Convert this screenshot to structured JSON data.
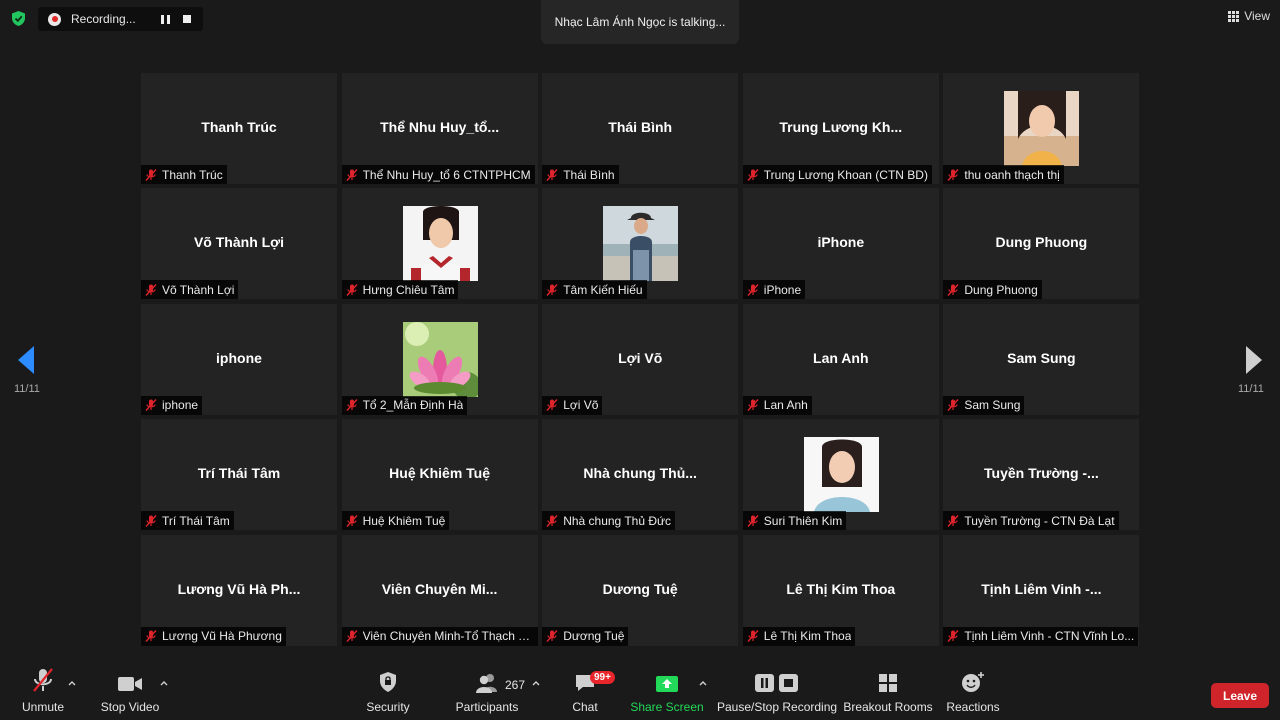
{
  "recording": {
    "label": "Recording..."
  },
  "talking": "Nhạc Lâm Ánh Ngọc is talking...",
  "view": {
    "label": "View"
  },
  "pagination": {
    "left": "11/11",
    "right": "11/11"
  },
  "tiles": [
    {
      "name": "Thanh Trúc",
      "label": "Thanh Trúc",
      "photo": null
    },
    {
      "name": "Thể Nhu Huy_tổ...",
      "label": "Thể Nhu Huy_tổ 6 CTNTPHCM",
      "photo": null
    },
    {
      "name": "Thái Bình",
      "label": "Thái Bình",
      "photo": null
    },
    {
      "name": "Trung Lương Kh...",
      "label": "Trung Lương Khoan (CTN BD)",
      "photo": null
    },
    {
      "name": "",
      "label": "thu oanh thạch thị",
      "photo": "woman-photo"
    },
    {
      "name": "Võ Thành Lợi",
      "label": "Võ Thành Lợi",
      "photo": null
    },
    {
      "name": "",
      "label": "Hưng Chiêu Tâm",
      "photo": "uniform-photo"
    },
    {
      "name": "",
      "label": "Tâm Kiến Hiếu",
      "photo": "beach-photo"
    },
    {
      "name": "iPhone",
      "label": "iPhone",
      "photo": null
    },
    {
      "name": "Dung Phuong",
      "label": "Dung Phuong",
      "photo": null
    },
    {
      "name": "iphone",
      "label": "iphone",
      "photo": null
    },
    {
      "name": "",
      "label": "Tổ 2_Mẫn Định Hà",
      "photo": "lotus-photo"
    },
    {
      "name": "Lợi Võ",
      "label": "Lợi Võ",
      "photo": null
    },
    {
      "name": "Lan Anh",
      "label": "Lan Anh",
      "photo": null
    },
    {
      "name": "Sam Sung",
      "label": "Sam Sung",
      "photo": null
    },
    {
      "name": "Trí Thái Tâm",
      "label": "Trí Thái Tâm",
      "photo": null
    },
    {
      "name": "Huệ Khiêm Tuệ",
      "label": "Huệ Khiêm Tuệ",
      "photo": null
    },
    {
      "name": "Nhà chung Thủ...",
      "label": "Nhà chung Thủ Đức",
      "photo": null
    },
    {
      "name": "",
      "label": "Suri Thiên Kim",
      "photo": "portrait-photo"
    },
    {
      "name": "Tuyền Trường -...",
      "label": "Tuyền Trường - CTN Đà Lạt",
      "photo": null
    },
    {
      "name": "Lương Vũ Hà Ph...",
      "label": "Lương Vũ Hà Phương",
      "photo": null
    },
    {
      "name": "Viên Chuyên Mi...",
      "label": "Viên Chuyên Minh-Tổ Thạch T...",
      "photo": null
    },
    {
      "name": "Dương Tuệ",
      "label": "Dương Tuệ",
      "photo": null
    },
    {
      "name": "Lê Thị Kim Thoa",
      "label": "Lê Thị Kim Thoa",
      "photo": null
    },
    {
      "name": "Tịnh Liêm Vinh -...",
      "label": "Tịnh Liêm Vinh - CTN Vĩnh Lo...",
      "photo": null
    }
  ],
  "toolbar": {
    "unmute": "Unmute",
    "stop_video": "Stop Video",
    "security": "Security",
    "participants": "Participants",
    "participants_count": "267",
    "chat": "Chat",
    "chat_badge": "99+",
    "share_screen": "Share Screen",
    "recording": "Pause/Stop Recording",
    "breakout": "Breakout Rooms",
    "reactions": "Reactions",
    "leave": "Leave"
  },
  "colors": {
    "background": "#1a1a1a",
    "tile": "#232323",
    "accent_blue": "#2d8cff",
    "share_green": "#23d959",
    "leave_red": "#d0242b",
    "muted_red": "#e0242b"
  }
}
